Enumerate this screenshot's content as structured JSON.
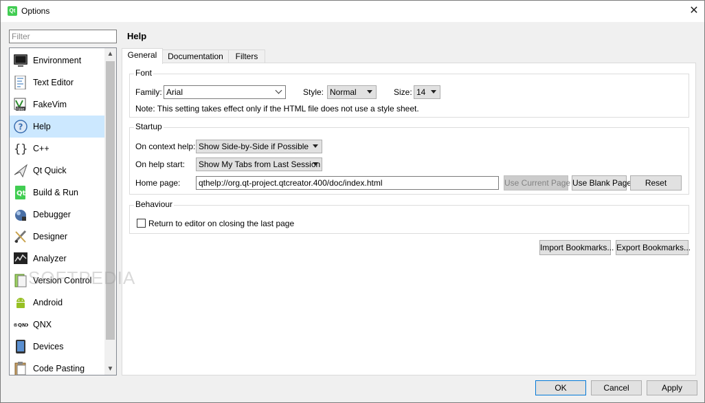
{
  "window": {
    "title": "Options",
    "close_symbol": "✕"
  },
  "filter": {
    "placeholder": "Filter",
    "value": ""
  },
  "sidebar": {
    "items": [
      {
        "label": "Environment",
        "icon": "monitor-icon"
      },
      {
        "label": "Text Editor",
        "icon": "text-editor-icon"
      },
      {
        "label": "FakeVim",
        "icon": "fakevim-icon"
      },
      {
        "label": "Help",
        "icon": "help-icon",
        "selected": true
      },
      {
        "label": "C++",
        "icon": "braces-icon"
      },
      {
        "label": "Qt Quick",
        "icon": "qt-quick-icon"
      },
      {
        "label": "Build & Run",
        "icon": "build-run-icon"
      },
      {
        "label": "Debugger",
        "icon": "debugger-icon"
      },
      {
        "label": "Designer",
        "icon": "designer-icon"
      },
      {
        "label": "Analyzer",
        "icon": "analyzer-icon"
      },
      {
        "label": "Version Control",
        "icon": "version-control-icon"
      },
      {
        "label": "Android",
        "icon": "android-icon"
      },
      {
        "label": "QNX",
        "icon": "qnx-icon"
      },
      {
        "label": "Devices",
        "icon": "devices-icon"
      },
      {
        "label": "Code Pasting",
        "icon": "code-pasting-icon"
      }
    ]
  },
  "page": {
    "title": "Help"
  },
  "tabs": [
    "General",
    "Documentation",
    "Filters"
  ],
  "font": {
    "group_title": "Font",
    "family_label": "Family:",
    "family_value": "Arial",
    "style_label": "Style:",
    "style_value": "Normal",
    "size_label": "Size:",
    "size_value": "14",
    "note": "Note: This setting takes effect only if the HTML file does not use a style sheet."
  },
  "startup": {
    "group_title": "Startup",
    "context_help_label": "On context help:",
    "context_help_value": "Show Side-by-Side if Possible",
    "help_start_label": "On help start:",
    "help_start_value": "Show My Tabs from Last Session",
    "home_page_label": "Home page:",
    "home_page_value": "qthelp://org.qt-project.qtcreator.400/doc/index.html",
    "use_current_page": "Use Current Page",
    "use_blank_page": "Use Blank Page",
    "reset": "Reset"
  },
  "behaviour": {
    "group_title": "Behaviour",
    "return_to_editor": "Return to editor on closing the last page",
    "return_to_editor_checked": false
  },
  "bookmarks": {
    "import": "Import Bookmarks...",
    "export": "Export Bookmarks..."
  },
  "footer": {
    "ok": "OK",
    "cancel": "Cancel",
    "apply": "Apply"
  },
  "watermark": "SOFTPEDIA",
  "colors": {
    "selection": "#cce8ff",
    "focus_border": "#0078d7",
    "qt_green": "#41cd52"
  }
}
